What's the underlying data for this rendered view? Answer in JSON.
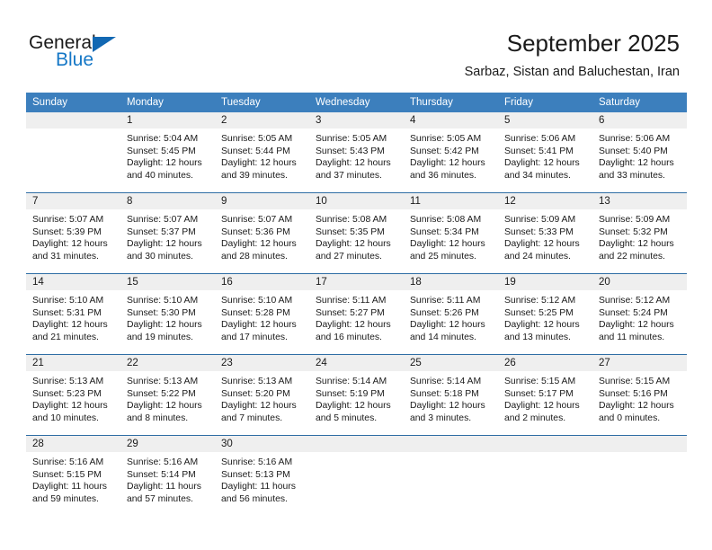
{
  "brand": {
    "name_part1": "General",
    "name_part2": "Blue",
    "logo_icon": "triangle-icon"
  },
  "header": {
    "title": "September 2025",
    "subtitle": "Sarbaz, Sistan and Baluchestan, Iran"
  },
  "colors": {
    "header_blue": "#3C7FBD",
    "separator_blue": "#2E6DA4",
    "daynum_band": "#EFEFEF",
    "brand_blue": "#1577c6",
    "text": "#1a1a1a"
  },
  "calendar": {
    "weekdays": [
      "Sunday",
      "Monday",
      "Tuesday",
      "Wednesday",
      "Thursday",
      "Friday",
      "Saturday"
    ],
    "weeks": [
      [
        {
          "day": "",
          "sunrise": "",
          "sunset": "",
          "daylight1": "",
          "daylight2": ""
        },
        {
          "day": "1",
          "sunrise": "Sunrise: 5:04 AM",
          "sunset": "Sunset: 5:45 PM",
          "daylight1": "Daylight: 12 hours",
          "daylight2": "and 40 minutes."
        },
        {
          "day": "2",
          "sunrise": "Sunrise: 5:05 AM",
          "sunset": "Sunset: 5:44 PM",
          "daylight1": "Daylight: 12 hours",
          "daylight2": "and 39 minutes."
        },
        {
          "day": "3",
          "sunrise": "Sunrise: 5:05 AM",
          "sunset": "Sunset: 5:43 PM",
          "daylight1": "Daylight: 12 hours",
          "daylight2": "and 37 minutes."
        },
        {
          "day": "4",
          "sunrise": "Sunrise: 5:05 AM",
          "sunset": "Sunset: 5:42 PM",
          "daylight1": "Daylight: 12 hours",
          "daylight2": "and 36 minutes."
        },
        {
          "day": "5",
          "sunrise": "Sunrise: 5:06 AM",
          "sunset": "Sunset: 5:41 PM",
          "daylight1": "Daylight: 12 hours",
          "daylight2": "and 34 minutes."
        },
        {
          "day": "6",
          "sunrise": "Sunrise: 5:06 AM",
          "sunset": "Sunset: 5:40 PM",
          "daylight1": "Daylight: 12 hours",
          "daylight2": "and 33 minutes."
        }
      ],
      [
        {
          "day": "7",
          "sunrise": "Sunrise: 5:07 AM",
          "sunset": "Sunset: 5:39 PM",
          "daylight1": "Daylight: 12 hours",
          "daylight2": "and 31 minutes."
        },
        {
          "day": "8",
          "sunrise": "Sunrise: 5:07 AM",
          "sunset": "Sunset: 5:37 PM",
          "daylight1": "Daylight: 12 hours",
          "daylight2": "and 30 minutes."
        },
        {
          "day": "9",
          "sunrise": "Sunrise: 5:07 AM",
          "sunset": "Sunset: 5:36 PM",
          "daylight1": "Daylight: 12 hours",
          "daylight2": "and 28 minutes."
        },
        {
          "day": "10",
          "sunrise": "Sunrise: 5:08 AM",
          "sunset": "Sunset: 5:35 PM",
          "daylight1": "Daylight: 12 hours",
          "daylight2": "and 27 minutes."
        },
        {
          "day": "11",
          "sunrise": "Sunrise: 5:08 AM",
          "sunset": "Sunset: 5:34 PM",
          "daylight1": "Daylight: 12 hours",
          "daylight2": "and 25 minutes."
        },
        {
          "day": "12",
          "sunrise": "Sunrise: 5:09 AM",
          "sunset": "Sunset: 5:33 PM",
          "daylight1": "Daylight: 12 hours",
          "daylight2": "and 24 minutes."
        },
        {
          "day": "13",
          "sunrise": "Sunrise: 5:09 AM",
          "sunset": "Sunset: 5:32 PM",
          "daylight1": "Daylight: 12 hours",
          "daylight2": "and 22 minutes."
        }
      ],
      [
        {
          "day": "14",
          "sunrise": "Sunrise: 5:10 AM",
          "sunset": "Sunset: 5:31 PM",
          "daylight1": "Daylight: 12 hours",
          "daylight2": "and 21 minutes."
        },
        {
          "day": "15",
          "sunrise": "Sunrise: 5:10 AM",
          "sunset": "Sunset: 5:30 PM",
          "daylight1": "Daylight: 12 hours",
          "daylight2": "and 19 minutes."
        },
        {
          "day": "16",
          "sunrise": "Sunrise: 5:10 AM",
          "sunset": "Sunset: 5:28 PM",
          "daylight1": "Daylight: 12 hours",
          "daylight2": "and 17 minutes."
        },
        {
          "day": "17",
          "sunrise": "Sunrise: 5:11 AM",
          "sunset": "Sunset: 5:27 PM",
          "daylight1": "Daylight: 12 hours",
          "daylight2": "and 16 minutes."
        },
        {
          "day": "18",
          "sunrise": "Sunrise: 5:11 AM",
          "sunset": "Sunset: 5:26 PM",
          "daylight1": "Daylight: 12 hours",
          "daylight2": "and 14 minutes."
        },
        {
          "day": "19",
          "sunrise": "Sunrise: 5:12 AM",
          "sunset": "Sunset: 5:25 PM",
          "daylight1": "Daylight: 12 hours",
          "daylight2": "and 13 minutes."
        },
        {
          "day": "20",
          "sunrise": "Sunrise: 5:12 AM",
          "sunset": "Sunset: 5:24 PM",
          "daylight1": "Daylight: 12 hours",
          "daylight2": "and 11 minutes."
        }
      ],
      [
        {
          "day": "21",
          "sunrise": "Sunrise: 5:13 AM",
          "sunset": "Sunset: 5:23 PM",
          "daylight1": "Daylight: 12 hours",
          "daylight2": "and 10 minutes."
        },
        {
          "day": "22",
          "sunrise": "Sunrise: 5:13 AM",
          "sunset": "Sunset: 5:22 PM",
          "daylight1": "Daylight: 12 hours",
          "daylight2": "and 8 minutes."
        },
        {
          "day": "23",
          "sunrise": "Sunrise: 5:13 AM",
          "sunset": "Sunset: 5:20 PM",
          "daylight1": "Daylight: 12 hours",
          "daylight2": "and 7 minutes."
        },
        {
          "day": "24",
          "sunrise": "Sunrise: 5:14 AM",
          "sunset": "Sunset: 5:19 PM",
          "daylight1": "Daylight: 12 hours",
          "daylight2": "and 5 minutes."
        },
        {
          "day": "25",
          "sunrise": "Sunrise: 5:14 AM",
          "sunset": "Sunset: 5:18 PM",
          "daylight1": "Daylight: 12 hours",
          "daylight2": "and 3 minutes."
        },
        {
          "day": "26",
          "sunrise": "Sunrise: 5:15 AM",
          "sunset": "Sunset: 5:17 PM",
          "daylight1": "Daylight: 12 hours",
          "daylight2": "and 2 minutes."
        },
        {
          "day": "27",
          "sunrise": "Sunrise: 5:15 AM",
          "sunset": "Sunset: 5:16 PM",
          "daylight1": "Daylight: 12 hours",
          "daylight2": "and 0 minutes."
        }
      ],
      [
        {
          "day": "28",
          "sunrise": "Sunrise: 5:16 AM",
          "sunset": "Sunset: 5:15 PM",
          "daylight1": "Daylight: 11 hours",
          "daylight2": "and 59 minutes."
        },
        {
          "day": "29",
          "sunrise": "Sunrise: 5:16 AM",
          "sunset": "Sunset: 5:14 PM",
          "daylight1": "Daylight: 11 hours",
          "daylight2": "and 57 minutes."
        },
        {
          "day": "30",
          "sunrise": "Sunrise: 5:16 AM",
          "sunset": "Sunset: 5:13 PM",
          "daylight1": "Daylight: 11 hours",
          "daylight2": "and 56 minutes."
        },
        {
          "day": "",
          "sunrise": "",
          "sunset": "",
          "daylight1": "",
          "daylight2": ""
        },
        {
          "day": "",
          "sunrise": "",
          "sunset": "",
          "daylight1": "",
          "daylight2": ""
        },
        {
          "day": "",
          "sunrise": "",
          "sunset": "",
          "daylight1": "",
          "daylight2": ""
        },
        {
          "day": "",
          "sunrise": "",
          "sunset": "",
          "daylight1": "",
          "daylight2": ""
        }
      ]
    ]
  }
}
